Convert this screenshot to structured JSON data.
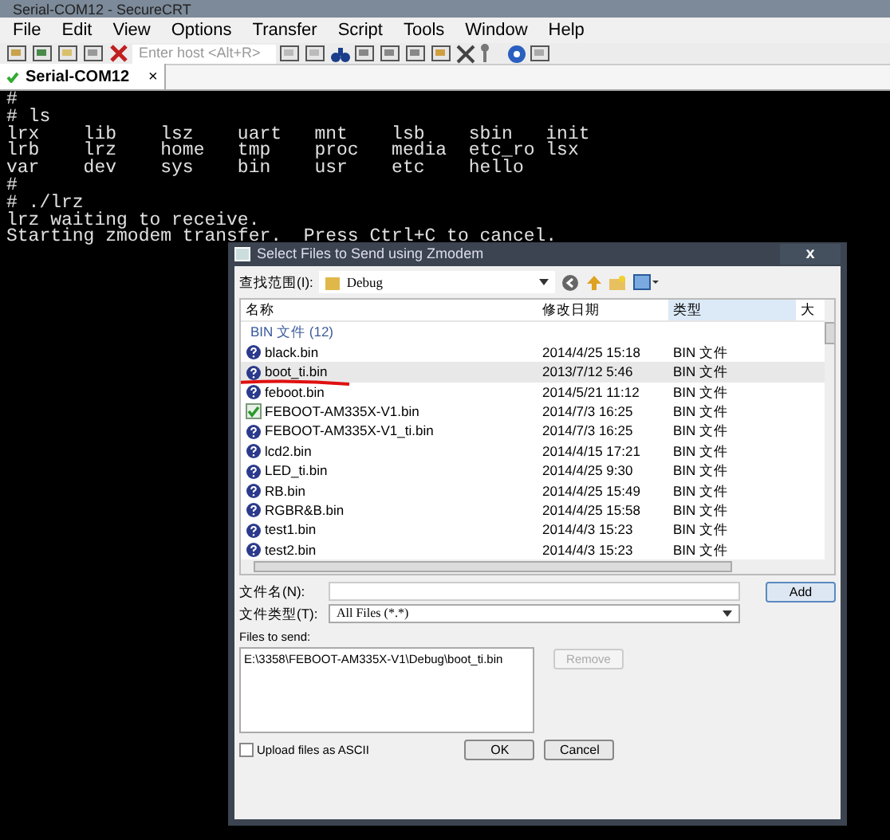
{
  "window": {
    "title": "Serial-COM12 - SecureCRT"
  },
  "menu": [
    "File",
    "Edit",
    "View",
    "Options",
    "Transfer",
    "Script",
    "Tools",
    "Window",
    "Help"
  ],
  "toolbar": {
    "host_placeholder": "Enter host <Alt+R>"
  },
  "tabs": [
    {
      "label": "Serial-COM12",
      "selected": true,
      "close": "×"
    }
  ],
  "terminal": {
    "lines": [
      "#",
      "# ls",
      "lrx    lib    lsz    uart   mnt    lsb    sbin   init",
      "lrb    lrz    home   tmp    proc   media  etc_ro lsx",
      "var    dev    sys    bin    usr    etc    hello",
      "#",
      "# ./lrz",
      "lrz waiting to receive.",
      "Starting zmodem transfer.  Press Ctrl+C to cancel."
    ]
  },
  "dialog": {
    "title": "Select Files to Send using Zmodem",
    "close": "x",
    "look_in_label": "查找范围(I):",
    "look_in_value": "Debug",
    "columns": [
      {
        "label": "名称",
        "selected": false
      },
      {
        "label": "修改日期",
        "selected": false
      },
      {
        "label": "类型",
        "selected": true
      },
      {
        "label": "大",
        "selected": false
      }
    ],
    "group": "BIN 文件 (12)",
    "rows": [
      {
        "name": "black.bin",
        "date": "2014/4/25 15:18",
        "type": "BIN 文件",
        "kind": "unknown",
        "selected": false,
        "underlined": false
      },
      {
        "name": "boot_ti.bin",
        "date": "2013/7/12 5:46",
        "type": "BIN 文件",
        "kind": "unknown",
        "selected": true,
        "underlined": true
      },
      {
        "name": "feboot.bin",
        "date": "2014/5/21 11:12",
        "type": "BIN 文件",
        "kind": "unknown",
        "selected": false,
        "underlined": false
      },
      {
        "name": "FEBOOT-AM335X-V1.bin",
        "date": "2014/7/3 16:25",
        "type": "BIN 文件",
        "kind": "app",
        "selected": false,
        "underlined": false
      },
      {
        "name": "FEBOOT-AM335X-V1_ti.bin",
        "date": "2014/7/3 16:25",
        "type": "BIN 文件",
        "kind": "unknown",
        "selected": false,
        "underlined": false
      },
      {
        "name": "lcd2.bin",
        "date": "2014/4/15 17:21",
        "type": "BIN 文件",
        "kind": "unknown",
        "selected": false,
        "underlined": false
      },
      {
        "name": "LED_ti.bin",
        "date": "2014/4/25 9:30",
        "type": "BIN 文件",
        "kind": "unknown",
        "selected": false,
        "underlined": false
      },
      {
        "name": "RB.bin",
        "date": "2014/4/25 15:49",
        "type": "BIN 文件",
        "kind": "unknown",
        "selected": false,
        "underlined": false
      },
      {
        "name": "RGBR&B.bin",
        "date": "2014/4/25 15:58",
        "type": "BIN 文件",
        "kind": "unknown",
        "selected": false,
        "underlined": false
      },
      {
        "name": "test1.bin",
        "date": "2014/4/3 15:23",
        "type": "BIN 文件",
        "kind": "unknown",
        "selected": false,
        "underlined": false
      },
      {
        "name": "test2.bin",
        "date": "2014/4/3 15:23",
        "type": "BIN 文件",
        "kind": "unknown",
        "selected": false,
        "underlined": false
      }
    ],
    "filename_label": "文件名(N):",
    "add_button": "Add",
    "filetype_label": "文件类型(T):",
    "filetype_value": "All Files (*.*)",
    "files_to_send_label": "Files to send:",
    "files_to_send": "E:\\3358\\FEBOOT-AM335X-V1\\Debug\\boot_ti.bin",
    "remove_button": {
      "label": "Remove",
      "disabled": true
    },
    "ascii": {
      "label": "Upload files as ASCII",
      "checked": false
    },
    "ok_button": "OK",
    "cancel_button": "Cancel"
  }
}
